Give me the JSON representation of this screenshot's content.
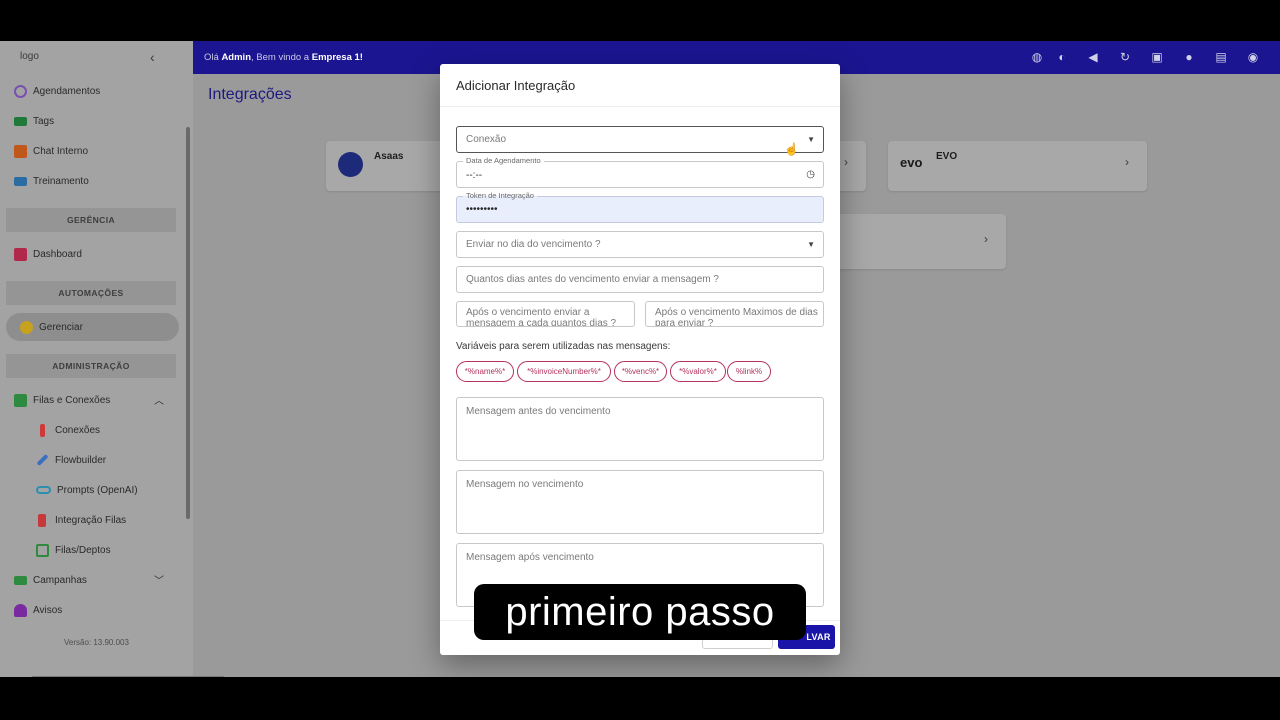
{
  "sidebar": {
    "logo_alt": "logo",
    "items": [
      {
        "label": "Agendamentos",
        "color": "#7a4fb0"
      },
      {
        "label": "Tags",
        "color": "#1f7a3a"
      },
      {
        "label": "Chat Interno",
        "color": "#c0581e"
      },
      {
        "label": "Treinamento",
        "color": "#2b6ca3"
      }
    ],
    "section_gerencia": "GERÊNCIA",
    "dashboard": "Dashboard",
    "section_automacoes": "AUTOMAÇÕES",
    "gerenciar": "Gerenciar",
    "section_administracao": "ADMINISTRAÇÃO",
    "filas_conexoes": "Filas e Conexões",
    "sub_items": [
      {
        "label": "Conexões"
      },
      {
        "label": "Flowbuilder"
      },
      {
        "label": "Prompts (OpenAI)"
      },
      {
        "label": "Integração Filas"
      },
      {
        "label": "Filas/Deptos"
      }
    ],
    "campanhas": "Campanhas",
    "avisos": "Avisos",
    "version": "Versão: 13.90.003"
  },
  "topbar": {
    "greet_prefix": "Olá ",
    "user": "Admin",
    "greet_mid": ", Bem vindo a ",
    "company": "Empresa 1",
    "greet_suffix": "!"
  },
  "page": {
    "title": "Integrações",
    "cards": [
      {
        "name": "Asaas"
      },
      {
        "name": "EVO",
        "logo": "evo"
      }
    ]
  },
  "modal": {
    "title": "Adicionar Integração",
    "conexao_placeholder": "Conexão",
    "data_label": "Data de Agendamento",
    "data_value": "--:--",
    "token_label": "Token de Integração",
    "token_value": "•••••••••",
    "enviar_dia_placeholder": "Enviar no dia do vencimento ?",
    "dias_antes_placeholder": "Quantos dias antes do vencimento enviar a mensagem ?",
    "apos_a_cada_line1": "Após o vencimento enviar a",
    "apos_a_cada_line2": "mensagem a cada quantos dias ?",
    "apos_max_line1": "Após o vencimento Maximos de dias",
    "apos_max_line2": "para enviar ?",
    "vars_label": "Variáveis para serem utilizadas nas mensagens:",
    "chips": [
      "*%name%*",
      "*%invoiceNumber%*",
      "*%venc%*",
      "*%valor%*",
      "%link%"
    ],
    "msg_antes": "Mensagem antes do vencimento",
    "msg_no": "Mensagem no vencimento",
    "msg_apos": "Mensagem após vencimento",
    "save_label": "LVAR"
  },
  "subtitle": "primeiro passo"
}
